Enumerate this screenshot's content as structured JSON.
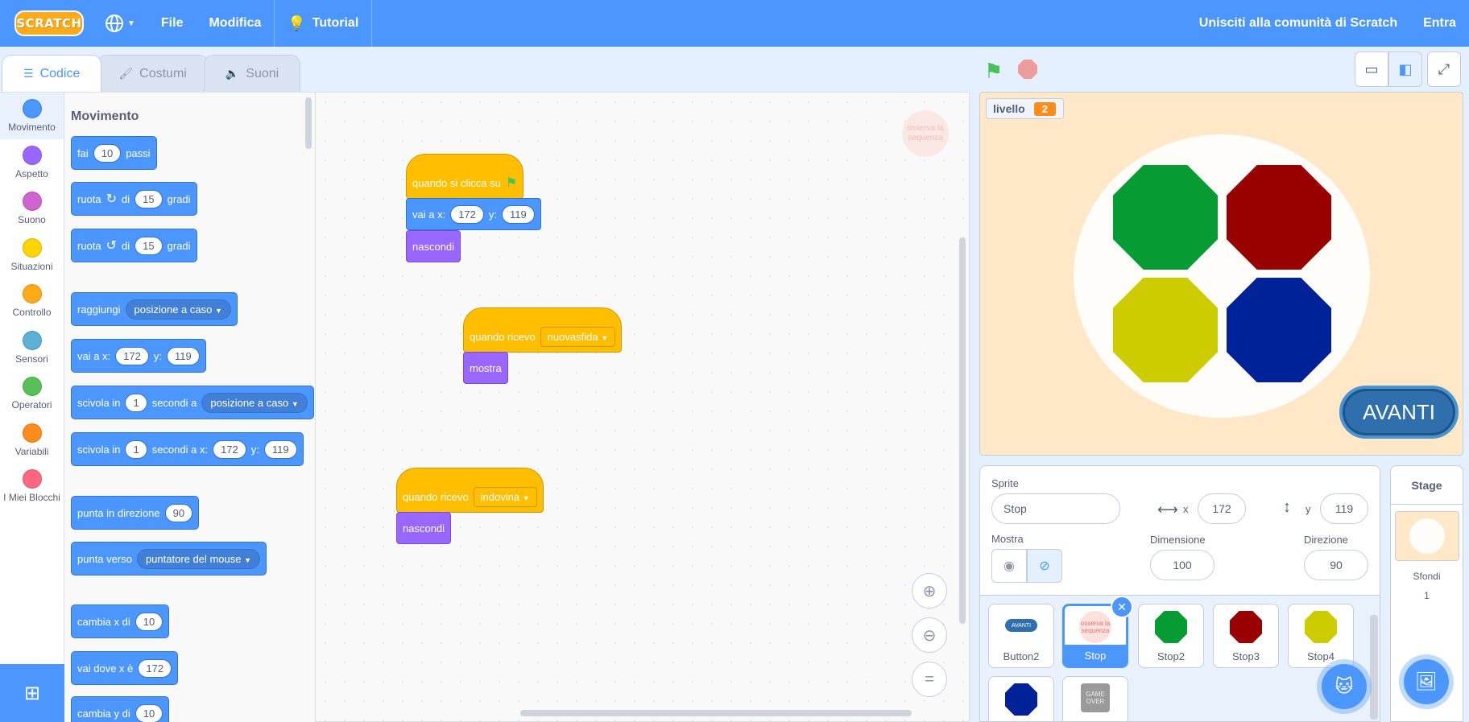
{
  "menubar": {
    "logo": "SCRATCH",
    "file": "File",
    "edit": "Modifica",
    "tutorial": "Tutorial",
    "join": "Unisciti alla comunità di Scratch",
    "signin": "Entra"
  },
  "tabs": {
    "code": "Codice",
    "costumes": "Costumi",
    "sounds": "Suoni"
  },
  "categories": [
    {
      "label": "Movimento",
      "color": "#4c97ff"
    },
    {
      "label": "Aspetto",
      "color": "#9966ff"
    },
    {
      "label": "Suono",
      "color": "#cf63cf"
    },
    {
      "label": "Situazioni",
      "color": "#ffd500"
    },
    {
      "label": "Controllo",
      "color": "#ffab19"
    },
    {
      "label": "Sensori",
      "color": "#5cb1d6"
    },
    {
      "label": "Operatori",
      "color": "#59c059"
    },
    {
      "label": "Variabili",
      "color": "#ff8c1a"
    },
    {
      "label": "I Miei Blocchi",
      "color": "#ff6680"
    }
  ],
  "palette": {
    "title": "Movimento",
    "move": {
      "a": "fai",
      "v": "10",
      "b": "passi"
    },
    "turn_right": {
      "a": "ruota",
      "b": "di",
      "v": "15",
      "c": "gradi"
    },
    "turn_left": {
      "a": "ruota",
      "b": "di",
      "v": "15",
      "c": "gradi"
    },
    "goto": {
      "a": "raggiungi",
      "dd": "posizione a caso"
    },
    "gotoxy": {
      "a": "vai a x:",
      "x": "172",
      "b": "y:",
      "y": "119"
    },
    "glide": {
      "a": "scivola in",
      "v": "1",
      "b": "secondi a",
      "dd": "posizione a caso"
    },
    "glidexy": {
      "a": "scivola in",
      "v": "1",
      "b": "secondi a x:",
      "x": "172",
      "c": "y:",
      "y": "119"
    },
    "point_dir": {
      "a": "punta in direzione",
      "v": "90"
    },
    "point_to": {
      "a": "punta verso",
      "dd": "puntatore del mouse"
    },
    "change_x": {
      "a": "cambia x di",
      "v": "10"
    },
    "set_x": {
      "a": "vai dove x è",
      "v": "172"
    },
    "change_y": {
      "a": "cambia y di",
      "v": "10"
    }
  },
  "code": {
    "ghost": "osserva la sequenza",
    "script1": {
      "hat": "quando si clicca su",
      "goto_a": "vai a x:",
      "x": "172",
      "goto_b": "y:",
      "y": "119",
      "hide": "nascondi"
    },
    "script2": {
      "hat": "quando ricevo",
      "msg": "nuovasfida",
      "show": "mostra"
    },
    "script3": {
      "hat": "quando ricevo",
      "msg": "indovina",
      "hide": "nascondi"
    }
  },
  "stage": {
    "monitor_label": "livello",
    "monitor_value": "2",
    "button": "AVANTI",
    "octagons": [
      "#079b33",
      "#990000",
      "#cccc00",
      "#002299"
    ]
  },
  "sprite_info": {
    "sprite_label": "Sprite",
    "sprite_name": "Stop",
    "x_label": "x",
    "x": "172",
    "y_label": "y",
    "y": "119",
    "show_label": "Mostra",
    "size_label": "Dimensione",
    "size": "100",
    "dir_label": "Direzione",
    "dir": "90"
  },
  "sprites": [
    {
      "name": "Button2",
      "thumb": "AVANTI"
    },
    {
      "name": "Stop",
      "thumb": "osserva la sequenza"
    },
    {
      "name": "Stop2"
    },
    {
      "name": "Stop3"
    },
    {
      "name": "Stop4"
    },
    {
      "name": ""
    },
    {
      "name": "",
      "thumb": "GAME OVER"
    }
  ],
  "stage_panel": {
    "title": "Stage",
    "backdrops_label": "Sfondi",
    "backdrops_count": "1"
  }
}
